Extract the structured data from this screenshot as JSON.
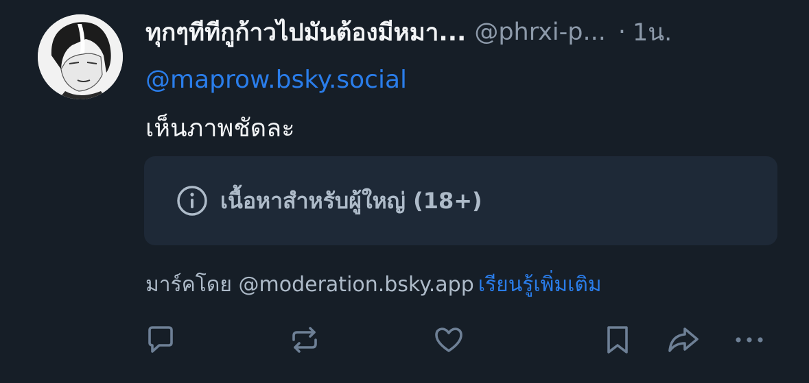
{
  "post": {
    "display_name": "ทุกๆทีทีกูก้าวไปมันต้องมีหมา...",
    "handle": "@phrxi-p...",
    "separator": "·",
    "time": "1น.",
    "mention": "@maprow.bsky.social",
    "text": "เห็นภาพชัดละ"
  },
  "content_warning": {
    "label": "เนื้อหาสำหรับผู้ใหญ่ (18+)",
    "icon": "info-icon"
  },
  "moderation": {
    "labeled_by": "มาร์คโดย @moderation.bsky.app",
    "learn_more": "เรียนรู้เพิ่มเติม"
  },
  "actions": [
    {
      "name": "reply",
      "icon": "reply-icon"
    },
    {
      "name": "repost",
      "icon": "repost-icon"
    },
    {
      "name": "like",
      "icon": "heart-icon"
    },
    {
      "name": "bookmark",
      "icon": "bookmark-icon"
    },
    {
      "name": "share",
      "icon": "share-icon"
    },
    {
      "name": "more",
      "icon": "more-icon"
    }
  ],
  "colors": {
    "background": "#161e27",
    "accent": "#2a7dea",
    "muted": "#8d9aaa",
    "box": "#1e2937",
    "icon": "#6e8096"
  }
}
